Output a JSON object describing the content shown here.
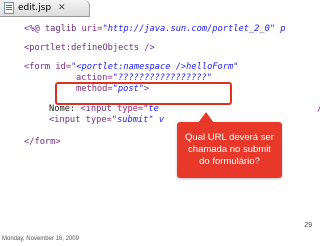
{
  "editor": {
    "tab_title": "edit.jsp",
    "file_icon": "jsp-file-icon",
    "close_icon": "close-icon",
    "close_glyph": "✕"
  },
  "code": {
    "taglib": {
      "open": "<%@ ",
      "directive": "taglib ",
      "attr": "uri=",
      "value": "\"http://java.sun.com/portlet_2_0\" p"
    },
    "define_objects": "<portlet:defineObjects />",
    "form": {
      "open": "<form ",
      "id_attr": "id=",
      "id_value_part1": "\"<portlet:namespace />",
      "id_value_part2": "helloForm\"",
      "action_attr": "action=",
      "action_value": "\"?????????????????\"",
      "method_attr": "method=",
      "method_value": "\"post\"",
      "method_close": ">"
    },
    "nome": {
      "label": "Nome:",
      "input_open": " <input ",
      "type_attr": "type=",
      "type_value": "\"te",
      "close": "/>"
    },
    "submit": {
      "input_open": "<input ",
      "type_attr": "type=",
      "type_value": "\"submit\" v"
    },
    "form_close": "</form>"
  },
  "callout": {
    "text": "Qual URL deverá ser chamada no submit do formulário?"
  },
  "colors": {
    "callout_bg": "#e8382a",
    "highlight_border": "#e0301e",
    "tag_color": "#6f2b8b",
    "string_color": "#2222ff"
  },
  "slide": {
    "page_number": "29",
    "date": "Monday, November 16, 2009"
  }
}
